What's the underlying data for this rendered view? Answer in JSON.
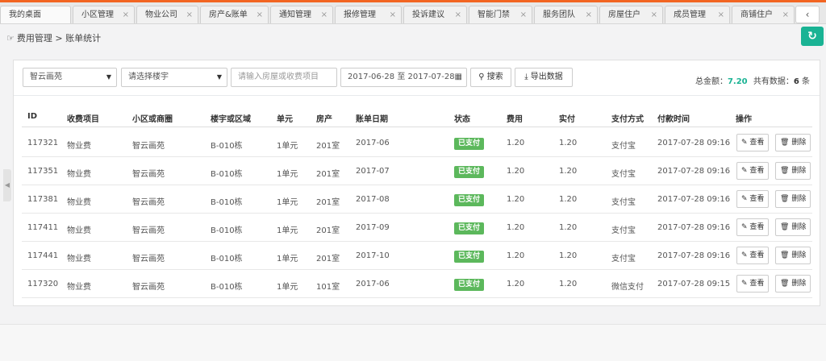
{
  "tabs": [
    {
      "label": "我的桌面",
      "closable": false
    },
    {
      "label": "小区管理",
      "closable": true
    },
    {
      "label": "物业公司",
      "closable": true
    },
    {
      "label": "房产&账单",
      "closable": true
    },
    {
      "label": "通知管理",
      "closable": true
    },
    {
      "label": "报修管理",
      "closable": true
    },
    {
      "label": "投诉建议",
      "closable": true
    },
    {
      "label": "智能门禁",
      "closable": true
    },
    {
      "label": "服务团队",
      "closable": true
    },
    {
      "label": "房屋住户",
      "closable": true
    },
    {
      "label": "成员管理",
      "closable": true
    },
    {
      "label": "商铺住户",
      "closable": true
    }
  ],
  "tab_close_glyph": "×",
  "tab_nav": {
    "prev": "‹",
    "next": "›"
  },
  "breadcrumb": {
    "parent": "费用管理",
    "separator": ">",
    "current": "账单统计"
  },
  "filters": {
    "community": "智云画苑",
    "building_placeholder": "请选择楼宇",
    "search_placeholder": "请输入房屋或收费项目",
    "date_from": "2017-06-28",
    "date_sep": "至",
    "date_to": "2017-07-28",
    "search_label": "搜索",
    "export_label": "导出数据"
  },
  "summary": {
    "total_label": "总金额：",
    "total_value": "7.20",
    "count_label": "共有数据：",
    "count_value": "6",
    "count_unit": "条"
  },
  "columns": [
    "ID",
    "收费项目",
    "小区或商圈",
    "楼宇或区域",
    "单元",
    "房产",
    "账单日期",
    "状态",
    "费用",
    "实付",
    "支付方式",
    "付款时间",
    "操作"
  ],
  "rows": [
    {
      "id": "117321",
      "item": "物业费",
      "community": "智云画苑",
      "building": "B-010栋",
      "unit": "1单元",
      "room": "201室",
      "bill_date": "2017-06",
      "status": "已支付",
      "fee": "1.20",
      "paid": "1.20",
      "pay_method": "支付宝",
      "pay_time": "2017-07-28 09:16"
    },
    {
      "id": "117351",
      "item": "物业费",
      "community": "智云画苑",
      "building": "B-010栋",
      "unit": "1单元",
      "room": "201室",
      "bill_date": "2017-07",
      "status": "已支付",
      "fee": "1.20",
      "paid": "1.20",
      "pay_method": "支付宝",
      "pay_time": "2017-07-28 09:16"
    },
    {
      "id": "117381",
      "item": "物业费",
      "community": "智云画苑",
      "building": "B-010栋",
      "unit": "1单元",
      "room": "201室",
      "bill_date": "2017-08",
      "status": "已支付",
      "fee": "1.20",
      "paid": "1.20",
      "pay_method": "支付宝",
      "pay_time": "2017-07-28 09:16"
    },
    {
      "id": "117411",
      "item": "物业费",
      "community": "智云画苑",
      "building": "B-010栋",
      "unit": "1单元",
      "room": "201室",
      "bill_date": "2017-09",
      "status": "已支付",
      "fee": "1.20",
      "paid": "1.20",
      "pay_method": "支付宝",
      "pay_time": "2017-07-28 09:16"
    },
    {
      "id": "117441",
      "item": "物业费",
      "community": "智云画苑",
      "building": "B-010栋",
      "unit": "1单元",
      "room": "201室",
      "bill_date": "2017-10",
      "status": "已支付",
      "fee": "1.20",
      "paid": "1.20",
      "pay_method": "支付宝",
      "pay_time": "2017-07-28 09:16"
    },
    {
      "id": "117320",
      "item": "物业费",
      "community": "智云画苑",
      "building": "B-010栋",
      "unit": "1单元",
      "room": "101室",
      "bill_date": "2017-06",
      "status": "已支付",
      "fee": "1.20",
      "paid": "1.20",
      "pay_method": "微信支付",
      "pay_time": "2017-07-28 09:15"
    }
  ],
  "actions": {
    "view_label": "查看",
    "delete_label": "删除"
  },
  "colors": {
    "accent": "#1ab394",
    "tab_top": "#f26522",
    "badge_paid": "#5cb85c"
  },
  "icons": {
    "breadcrumb": "hand-pointer-icon",
    "refresh": "refresh-icon",
    "search": "search-icon",
    "export": "download-icon",
    "calendar": "calendar-icon",
    "view": "edit-icon",
    "delete": "trash-icon"
  }
}
